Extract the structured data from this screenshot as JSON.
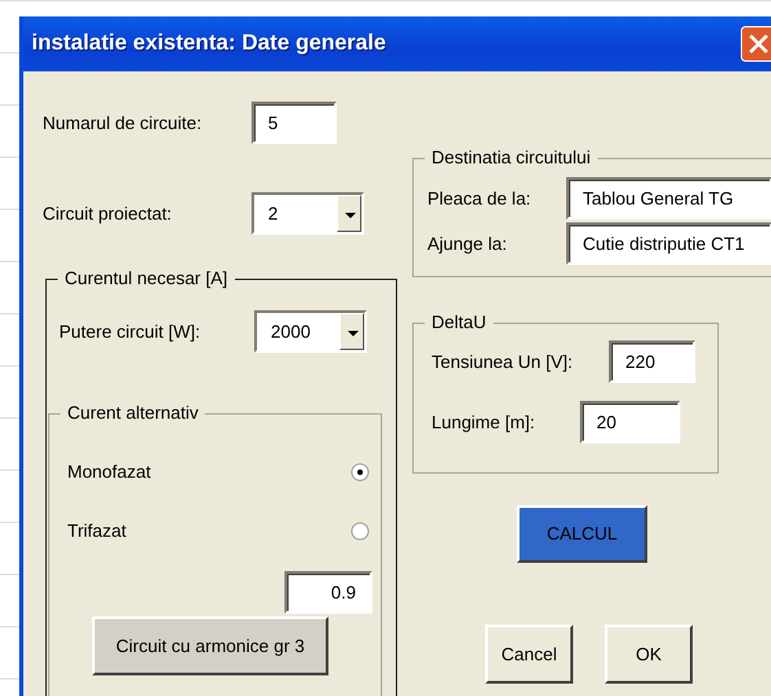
{
  "window": {
    "title": "instalatie existenta: Date generale"
  },
  "fields": [
    {
      "label": "Numarul de circuite:",
      "value": "5",
      "kind": "text"
    },
    {
      "label": "Circuit proiectat:",
      "value": "2",
      "kind": "combo"
    }
  ],
  "current_frame": {
    "title": "Curentul necesar [A]",
    "power": {
      "label": "Putere circuit [W]:",
      "value": "2000"
    },
    "ac_frame": {
      "title": "Curent alternativ",
      "options": [
        {
          "label": "Monofazat",
          "selected": true
        },
        {
          "label": "Trifazat",
          "selected": false
        }
      ],
      "factor": "0.9",
      "button": "Circuit cu armonice gr 3"
    }
  },
  "destination": {
    "title": "Destinatia circuitului",
    "fields": [
      {
        "label": "Pleaca de la:",
        "value": "Tablou General TG"
      },
      {
        "label": "Ajunge la:",
        "value": "Cutie distriputie CT1"
      }
    ]
  },
  "delta_u": {
    "title": "DeltaU",
    "fields": [
      {
        "label": "Tensiunea Un [V]:",
        "value": "220"
      },
      {
        "label": "Lungime [m]:",
        "value": "20"
      }
    ]
  },
  "calc_button": "CALCUL",
  "buttons": [
    "Cancel",
    "OK"
  ]
}
